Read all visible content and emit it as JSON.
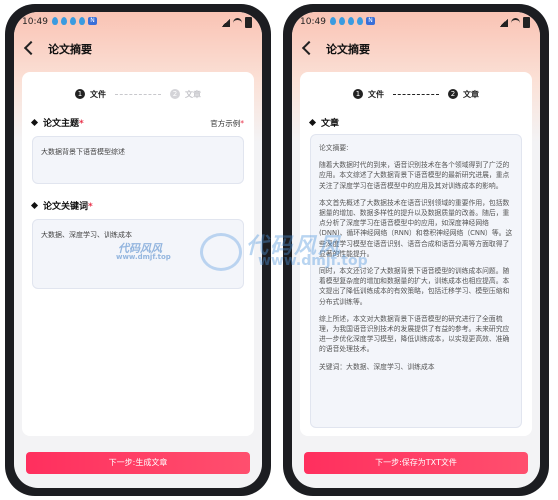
{
  "left": {
    "status": {
      "time": "10:49",
      "n_badge": "N"
    },
    "title": "论文摘要",
    "steps": [
      {
        "num": "1",
        "label": "文件"
      },
      {
        "num": "2",
        "label": "文章"
      }
    ],
    "topic": {
      "label": "论文主题",
      "required": "*",
      "example_link": "官方示例",
      "example_star": "*",
      "value": "大数据背景下语音模型综述"
    },
    "keywords": {
      "label": "论文关键词",
      "required": "*",
      "value": "大数据、深度学习、训练成本"
    },
    "button": "下一步:生成文章"
  },
  "right": {
    "status": {
      "time": "10:49",
      "n_badge": "N"
    },
    "title": "论文摘要",
    "steps": [
      {
        "num": "1",
        "label": "文件"
      },
      {
        "num": "2",
        "label": "文章"
      }
    ],
    "section_label": "文章",
    "article": {
      "heading": "论文摘要:",
      "p1": "随着大数据时代的到来，语音识别技术在各个领域得到了广泛的应用。本文综述了大数据背景下语音模型的最新研究进展，重点关注了深度学习在语音模型中的应用及其对训练成本的影响。",
      "p2": "本文首先概述了大数据技术在语音识别领域的重要作用，包括数据量的增加、数据多样性的提升以及数据质量的改善。随后，重点分析了深度学习在语音模型中的应用，如深度神经网络(DNN)、循环神经网络（RNN）和卷积神经网络（CNN）等。这些深度学习模型在语音识别、语音合成和语音分离等方面取得了显著的性能提升。",
      "p3": "同时，本文还讨论了大数据背景下语音模型的训练成本问题。随着模型复杂度的增加和数据量的扩大，训练成本也相应提高。本文提出了降低训练成本的有效策略，包括迁移学习、模型压缩和分布式训练等。",
      "p4": "综上所述，本文对大数据背景下语音模型的研究进行了全面梳理，为我国语音识别技术的发展提供了有益的参考。未来研究应进一步优化深度学习模型，降低训练成本，以实现更高效、准确的语音处理技术。",
      "keywords_line": "关键词：大数据、深度学习、训练成本"
    },
    "button": "下一步:保存为TXT文件"
  },
  "watermark": {
    "text1": "代码风风",
    "url1": "www.dmjf.top",
    "text2": "代码风风",
    "url2": "www.dmjf.top"
  },
  "colors": {
    "accent": "#ff3a63",
    "header_gradient_top": "#f9c3b4"
  }
}
